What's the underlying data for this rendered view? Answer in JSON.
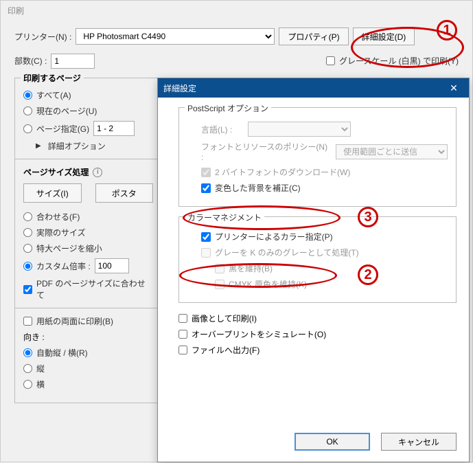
{
  "window": {
    "title": "印刷"
  },
  "printer": {
    "label": "プリンター(N) :",
    "selected": "HP Photosmart C4490",
    "properties_btn": "プロパティ(P)",
    "advanced_btn": "詳細設定(D)"
  },
  "copies": {
    "label": "部数(C) :",
    "value": "1"
  },
  "grayscale": {
    "label": "グレースケール (白黒) で印刷(Y)"
  },
  "pages": {
    "group_title": "印刷するページ",
    "all": "すべて(A)",
    "current": "現在のページ(U)",
    "range": "ページ指定(G)",
    "range_value": "1 - 2",
    "more": "詳細オプション"
  },
  "sizing": {
    "group_title": "ページサイズ処理",
    "tab_size": "サイズ(I)",
    "tab_poster": "ポスタ",
    "fit": "合わせる(F)",
    "actual": "実際のサイズ",
    "shrink": "特大ページを縮小",
    "custom": "カスタム倍率 :",
    "custom_value": "100",
    "pdf_pagesize": "PDF のページサイズに合わせて"
  },
  "both_sides": {
    "label": "用紙の両面に印刷(B)"
  },
  "orientation": {
    "label": "向き :",
    "auto": "自動縦 / 横(R)",
    "portrait": "縦",
    "landscape": "横"
  },
  "adv": {
    "title": "詳細設定",
    "ps_group": "PostScript オプション",
    "lang_label": "言語(L) :",
    "font_policy_label": "フォントとリソースのポリシー(N) :",
    "font_policy_value": "使用範囲ごとに送信",
    "download_2byte": "2 バイトフォントのダウンロード(W)",
    "compensate_bg": "変色した背景を補正(C)",
    "cm_group": "カラーマネジメント",
    "printer_color": "プリンターによるカラー指定(P)",
    "gray_k": "グレーを K のみのグレーとして処理(T)",
    "preserve_black": "黒を維持(B)",
    "preserve_cmyk": "CMYK 原色を維持(K)",
    "print_as_image": "画像として印刷(I)",
    "simulate_overprint": "オーバープリントをシミュレート(O)",
    "output_file": "ファイルへ出力(F)",
    "ok": "OK",
    "cancel": "キャンセル"
  },
  "annotations": {
    "n1": "1",
    "n2": "2",
    "n3": "3"
  }
}
